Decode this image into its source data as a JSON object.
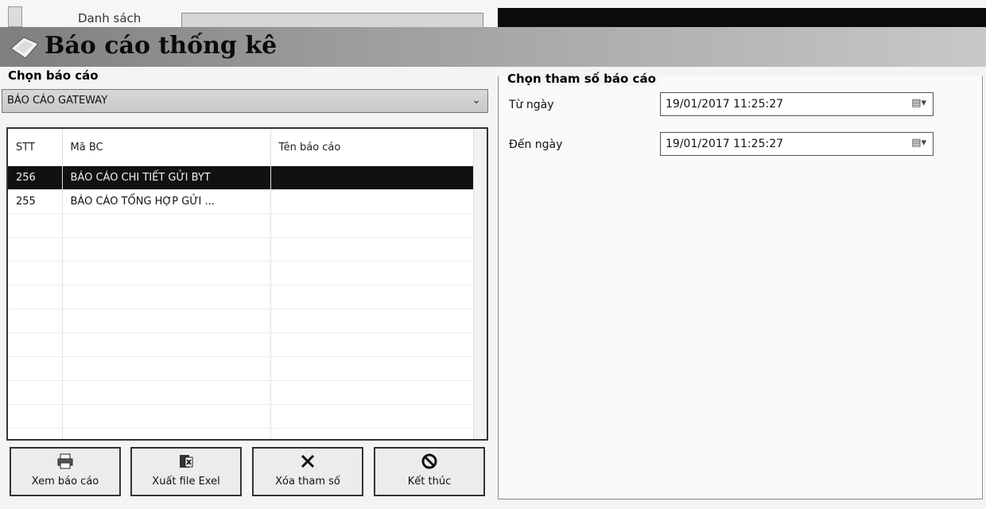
{
  "top": {
    "partial_label": "Danh sách"
  },
  "window": {
    "title": "Báo cáo thống kê"
  },
  "left": {
    "group_label": "Chọn báo cáo",
    "selected_report_type": "BÁO CÁO GATEWAY",
    "columns": [
      "STT",
      "Mã BC",
      "Tên báo cáo"
    ],
    "rows": [
      {
        "stt": "256",
        "ma_bc": "BÁO CÁO CHI TIẾT GỬI BYT",
        "ten": "",
        "selected": true
      },
      {
        "stt": "255",
        "ma_bc": "BÁO CÁO TỔNG HỢP GỬI ...",
        "ten": "",
        "selected": false
      }
    ]
  },
  "buttons": {
    "view": {
      "label": "Xem báo cáo",
      "icon": "printer-icon"
    },
    "export": {
      "label": "Xuất file Exel",
      "icon": "excel-icon"
    },
    "clear": {
      "label": "Xóa tham số",
      "icon": "x-icon"
    },
    "exit": {
      "label": "Kết thúc",
      "icon": "stop-icon"
    }
  },
  "right": {
    "group_label": "Chọn tham số báo cáo",
    "from_label": "Từ ngày",
    "from_value": "19/01/2017 11:25:27",
    "to_label": "Đến ngày",
    "to_value": "19/01/2017 11:25:27"
  }
}
